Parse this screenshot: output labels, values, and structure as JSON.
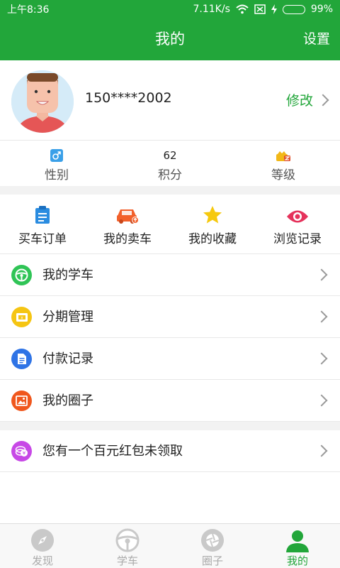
{
  "status": {
    "time": "上午8:36",
    "speed": "7.11K/s",
    "battery": "99%",
    "battery_level": 0.99
  },
  "header": {
    "title": "我的",
    "settings": "设置"
  },
  "profile": {
    "phone": "150****2002",
    "edit": "修改"
  },
  "stats": [
    {
      "value": "",
      "icon": "male-gender-icon",
      "label": "性别"
    },
    {
      "value": "62",
      "icon": "",
      "label": "积分"
    },
    {
      "value": "",
      "icon": "level-badge-icon",
      "label": "等级"
    }
  ],
  "quick": [
    {
      "label": "买车订单",
      "icon": "clipboard-icon",
      "color": "#2a8ce0"
    },
    {
      "label": "我的卖车",
      "icon": "car-icon",
      "color": "#f2602b"
    },
    {
      "label": "我的收藏",
      "icon": "star-icon",
      "color": "#f6c90e"
    },
    {
      "label": "浏览记录",
      "icon": "eye-icon",
      "color": "#e5325b"
    }
  ],
  "menu": [
    {
      "label": "我的学车",
      "icon": "steering-wheel-icon",
      "color": "#2fc456"
    },
    {
      "label": "分期管理",
      "icon": "card-icon",
      "color": "#f5c513"
    },
    {
      "label": "付款记录",
      "icon": "document-icon",
      "color": "#2f74e6"
    },
    {
      "label": "我的圈子",
      "icon": "image-icon",
      "color": "#f0571d"
    }
  ],
  "promo": {
    "label": "您有一个百元红包未领取",
    "icon": "coin-icon",
    "color": "#c748e6"
  },
  "tabs": [
    {
      "label": "发现",
      "icon": "compass-icon",
      "active": false
    },
    {
      "label": "学车",
      "icon": "steering-wheel-icon",
      "active": false
    },
    {
      "label": "圈子",
      "icon": "aperture-icon",
      "active": false
    },
    {
      "label": "我的",
      "icon": "user-icon",
      "active": true
    }
  ],
  "colors": {
    "accent": "#22a63a",
    "divider": "#e8e8e8",
    "inactive_tab": "#aaaaaa"
  }
}
